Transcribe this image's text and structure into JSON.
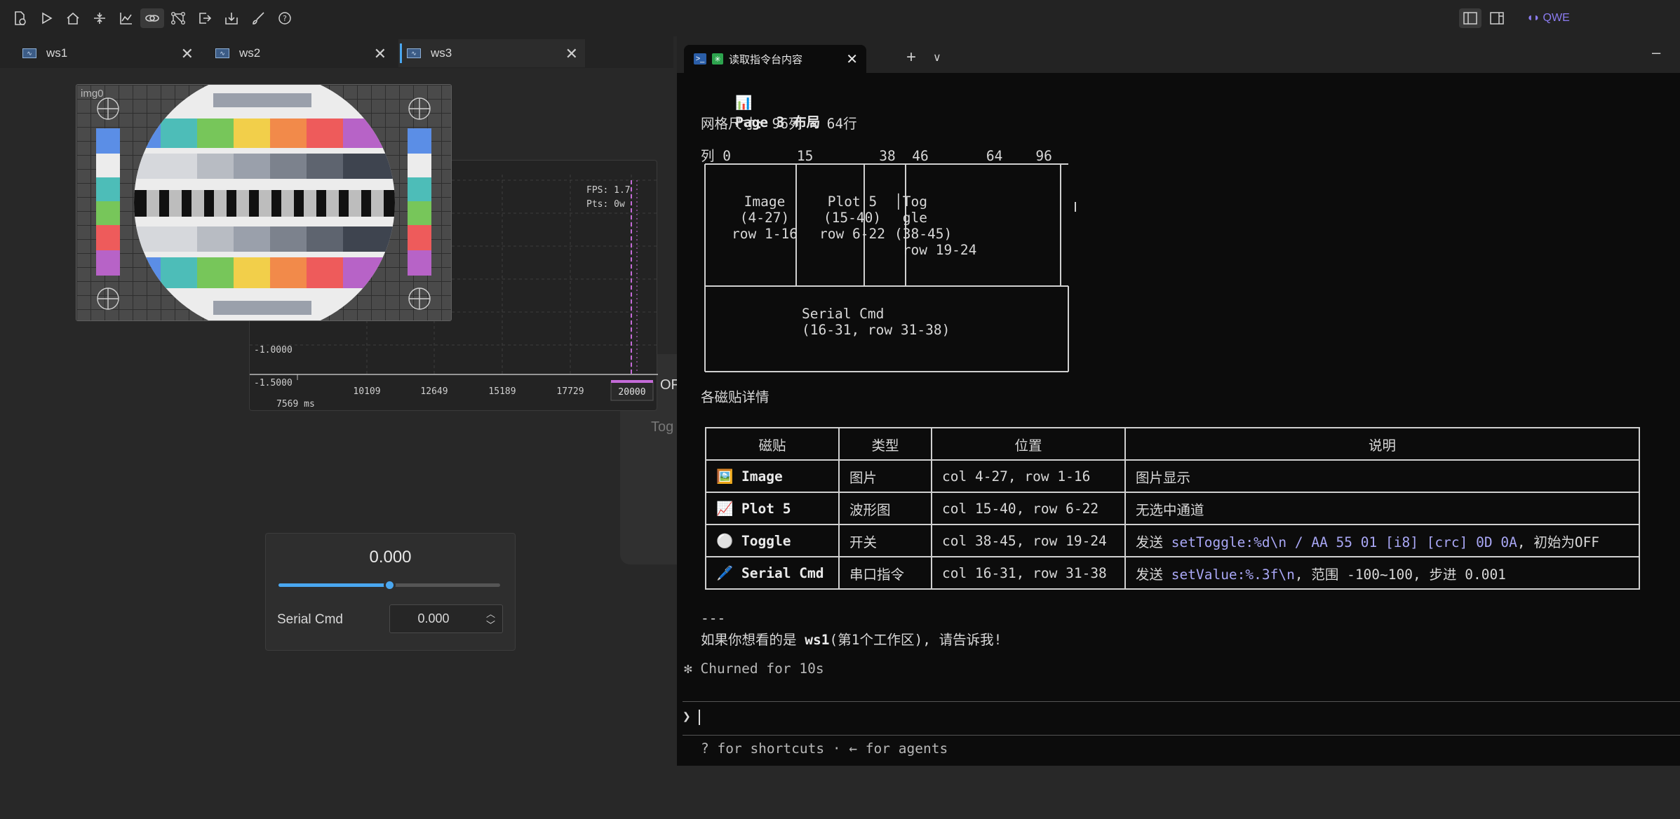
{
  "toolbar": {
    "icons": [
      "new-file-icon",
      "play-icon",
      "home-icon",
      "split-icon",
      "chart-icon",
      "link-icon",
      "network-icon",
      "export-icon",
      "import-icon",
      "brush-icon",
      "help-icon"
    ],
    "brand_label": "QWE"
  },
  "workspace_tabs": [
    {
      "label": "ws1",
      "active": false
    },
    {
      "label": "ws2",
      "active": false
    },
    {
      "label": "ws3",
      "active": true
    }
  ],
  "image_tile": {
    "label": "img0"
  },
  "plot": {
    "fps_label": "FPS: 1.7",
    "pts_label": "Pts: 0w",
    "y_ticks": [
      "-1.0000",
      "-1.5000"
    ],
    "x_ticks": [
      "10109",
      "12649",
      "15189",
      "17729",
      "20000"
    ],
    "time_label": "7569 ms"
  },
  "toggle": {
    "label": "Tog",
    "state": "OF"
  },
  "serial_cmd": {
    "display_value": "0.000",
    "label": "Serial Cmd",
    "input_value": "0.000",
    "slider_fraction": 0.5
  },
  "terminal": {
    "tab_title": "读取指令台内容",
    "page_heading": "Page 3 布局",
    "grid_size": "网格尺寸: 96列 × 64行",
    "ascii_lines": [
      "列 0        15        38  46       64    96",
      "┌──────────┬──────────┬────┬─────────────┐",
      "│          │          │    │            │",
      "│  Image   │  Plot 5  │Tog│            │",
      "│  (4-27)  │  (15-40) │gle │            │",
      "│ row 1-16 │ row 6-22││(38-45)│         │",
      "│          │          │row 19-24│        │",
      "│          │          │    │            │",
      "├──────────┴──────────┴────┴─────────────┤",
      "│                                         │",
      "│          Serial Cmd                     │",
      "│          (16-31, row 31-38)             │",
      "│                                         │",
      "└─────────────────────────────────────────┘"
    ],
    "details_heading": "各磁贴详情",
    "table": {
      "headers": [
        "磁贴",
        "类型",
        "位置",
        "说明"
      ],
      "rows": [
        {
          "icon": "🖼️",
          "name": "Image",
          "type": "图片",
          "pos": "col 4-27, row 1-16",
          "desc_pre": "图片显示",
          "desc_code": "",
          "desc_post": ""
        },
        {
          "icon": "📈",
          "name": "Plot 5",
          "type": "波形图",
          "pos": "col 15-40, row 6-22",
          "desc_pre": "无选中通道",
          "desc_code": "",
          "desc_post": ""
        },
        {
          "icon": "⚪",
          "name": "Toggle",
          "type": "开关",
          "pos": "col 38-45, row 19-24",
          "desc_pre": "发送 ",
          "desc_code": "setToggle:%d\\n / AA 55 01 [i8] [crc] 0D 0A",
          "desc_post": ", 初始为OFF"
        },
        {
          "icon": "🖊️",
          "name": "Serial Cmd",
          "type": "串口指令",
          "pos": "col 16-31, row 31-38",
          "desc_pre": "发送 ",
          "desc_code": "setValue:%.3f\\n",
          "desc_post": ", 范围 -100~100, 步进 0.001"
        }
      ]
    },
    "hr": "---",
    "closing_pre": "如果你想看的是 ",
    "closing_bold": "ws1",
    "closing_post": "(第1个工作区), 请告诉我!",
    "status": "✻ Churned for 10s",
    "prompt": "❯ ",
    "footer": "? for shortcuts · ← for agents"
  }
}
